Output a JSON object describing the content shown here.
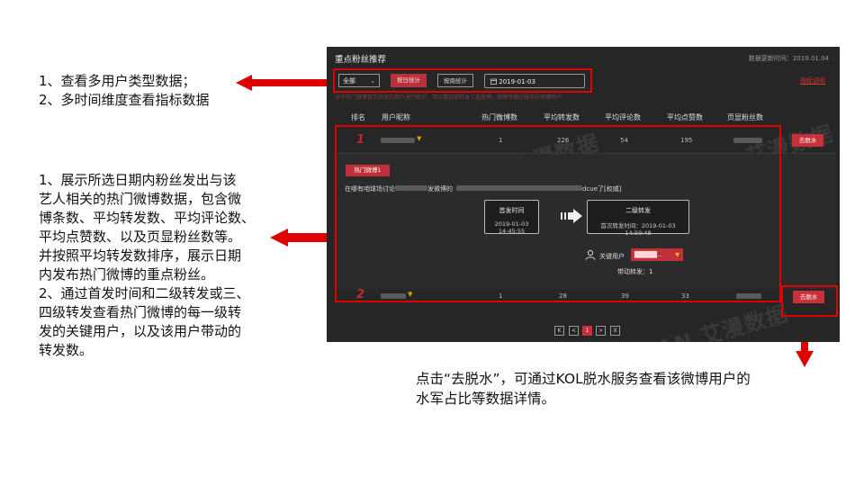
{
  "notes": {
    "n1": [
      "1、查看多用户类型数据；",
      "2、多时间维度查看指标数据"
    ],
    "n2": [
      "1、展示所选日期内粉丝发出与该",
      "艺人相关的热门微博数据，包含微",
      "博条数、平均转发数、平均评论数、",
      "平均点赞数、以及页显粉丝数等。",
      "并按照平均转发数排序，展示日期",
      "内发布热门微博的重点粉丝。",
      "2、通过首发时间和二级转发或三、",
      "四级转发查看热门微博的每一级转",
      "发的关键用户，以及该用户带动的",
      "转发数。"
    ],
    "n3": [
      "点击“去脱水”，可通过KOL脱水服务查看该微博用户的",
      "水军占比等数据详情。"
    ]
  },
  "panel": {
    "title": "重点粉丝推荐",
    "data_time": "数据更新时间：2019.01.04",
    "user_type": "全部",
    "btn_by_date": "按日统计",
    "btn_by_week": "按周统计",
    "date": "2019-01-03",
    "metric_link": "指标说明",
    "hint": "对于热门微博首次转发的用户进行统计，可以看到谁转发了此微博，微博传播过程中的关键用户",
    "headers": [
      "排名",
      "用户昵称",
      "热门微博数",
      "平均转发数",
      "平均评论数",
      "平均点赞数",
      "页显粉丝数"
    ],
    "rows": [
      {
        "rank": "1",
        "weibo": "1",
        "forward": "226",
        "comment": "54",
        "like": "195"
      },
      {
        "rank": "2",
        "weibo": "1",
        "forward": "28",
        "comment": "39",
        "like": "33"
      }
    ],
    "dehydrate_label": "去脱水",
    "detail": {
      "tag": "热门微博1",
      "text_a": "在哪有咱球场讨论",
      "text_b": "发微博的",
      "text_c": "dcue了[权威]",
      "first_title": "首发时间",
      "first_time": "2019-01-03 14:45:55",
      "second_title": "二级转发",
      "second_time": "首次转发时间：2019-01-03 14:59:48",
      "key_user_label": "关键用户",
      "key_user_value": "█████...",
      "driven": "带动转发：1"
    },
    "pages": [
      "K",
      "<",
      "1",
      ">",
      "X"
    ],
    "current_page": "1",
    "watermark": "MAN 艾漫数据"
  },
  "colors": {
    "accent": "#e00000",
    "button_red": "#c9303a",
    "panel_bg": "#262626"
  },
  "icons": [
    "left-arrow-icon",
    "down-arrow-icon",
    "chevron-down-icon",
    "calendar-icon",
    "user-icon",
    "flow-arrow-icon"
  ]
}
